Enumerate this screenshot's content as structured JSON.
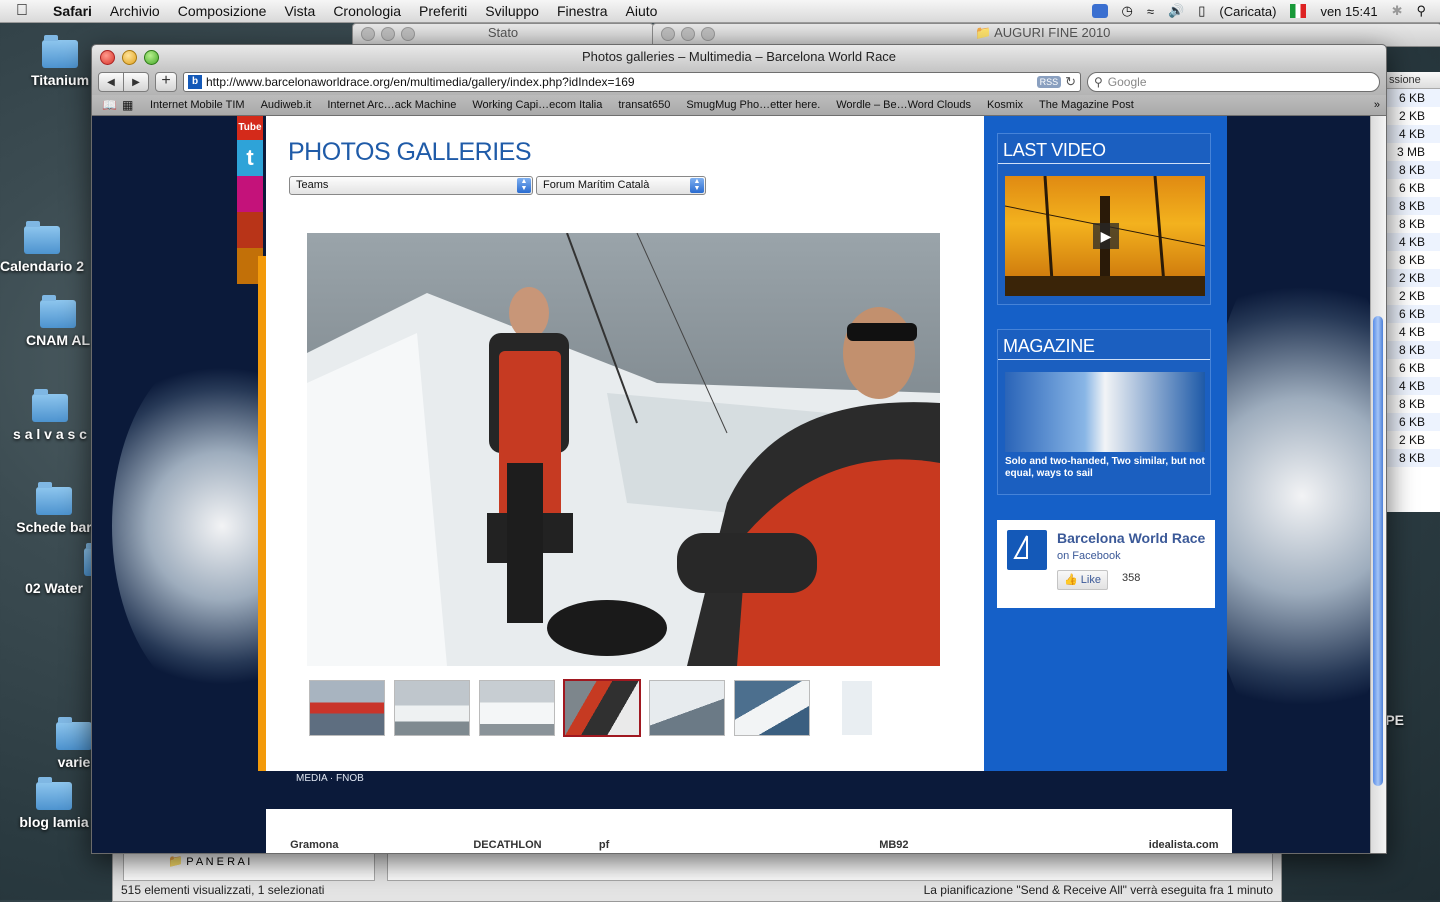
{
  "menubar": {
    "items": [
      "Safari",
      "Archivio",
      "Composizione",
      "Vista",
      "Cronologia",
      "Preferiti",
      "Sviluppo",
      "Finestra",
      "Aiuto"
    ],
    "battery": "(Caricata)",
    "clock": "ven 15:41"
  },
  "desktop": {
    "icons": [
      "Titanium",
      "Calendario 2",
      "CNAM AL",
      "s a l v a s c",
      "Schede bar",
      "02 Water",
      "varie",
      "blog lamia"
    ],
    "bg_window_1": "Stato",
    "bg_window_2": "AUGURI FINE 2010",
    "right_header": "ssione",
    "right_sizes": [
      "6 KB",
      "2 KB",
      "4 KB",
      "3 MB",
      "8 KB",
      "6 KB",
      "8 KB",
      "8 KB",
      "4 KB",
      "8 KB",
      "2 KB",
      "2 KB",
      "6 KB",
      "4 KB",
      "8 KB",
      "6 KB",
      "4 KB",
      "8 KB",
      "6 KB",
      "2 KB",
      "8 KB"
    ],
    "right_label": "YPE",
    "bottom": {
      "item": "P A N E R A I",
      "status_left": "515 elementi visualizzati, 1 selezionati",
      "status_right": "La pianificazione \"Send & Receive All\" verrà eseguita fra 1 minuto"
    }
  },
  "safari": {
    "title": "Photos galleries – Multimedia – Barcelona World Race",
    "url": "http://www.barcelonaworldrace.org/en/multimedia/gallery/index.php?idIndex=169",
    "rss": "RSS",
    "search_placeholder": "Google",
    "bookmarks": [
      "Internet Mobile TIM",
      "Audiweb.it",
      "Internet Arc…ack Machine",
      "Working Capi…ecom Italia",
      "transat650",
      "SmugMug Pho…etter here.",
      "Wordle – Be…Word Clouds",
      "Kosmix",
      "The Magazine Post"
    ]
  },
  "page": {
    "title": "PHOTOS GALLERIES",
    "select_1": "Teams",
    "select_2": "Forum Marítim Català",
    "social_youtube": "Tube",
    "footer_nav": "MEDIA  ·  FNOB",
    "sidebar": {
      "last_video_heading": "LAST VIDEO",
      "magazine_heading": "MAGAZINE",
      "magazine_caption": "Solo and two-handed, Two similar, but not equal, ways to sail"
    },
    "facebook": {
      "name": "Barcelona World Race",
      "suffix": "on Facebook",
      "like_label": "Like",
      "like_count": "358"
    },
    "sponsors": [
      "Gramona",
      "",
      "DECATHLON",
      "pf",
      "",
      "",
      "MB92",
      "",
      "",
      "idealista.com"
    ]
  }
}
